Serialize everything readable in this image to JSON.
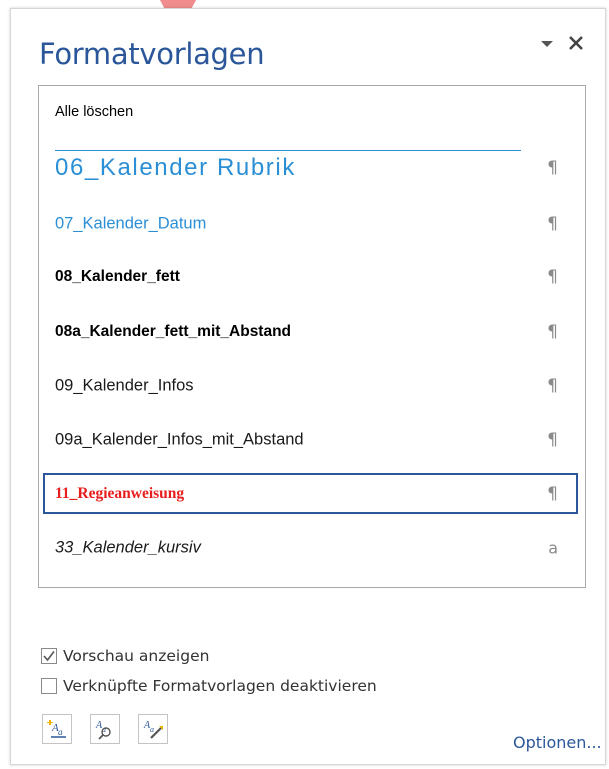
{
  "pane": {
    "title": "Formatvorlagen",
    "menu_icon": "dropdown-triangle-icon",
    "close_icon": "close-icon"
  },
  "styles": {
    "clear_all": "Alle löschen",
    "items": [
      {
        "label": "06_Kalender Rubrik",
        "mark": "¶"
      },
      {
        "label": "07_Kalender_Datum",
        "mark": "¶"
      },
      {
        "label": "08_Kalender_fett",
        "mark": "¶"
      },
      {
        "label": "08a_Kalender_fett_mit_Abstand",
        "mark": "¶"
      },
      {
        "label": "09_Kalender_Infos",
        "mark": "¶"
      },
      {
        "label": "09a_Kalender_Infos_mit_Abstand",
        "mark": "¶"
      },
      {
        "label": "11_Regieanweisung",
        "mark": "¶"
      },
      {
        "label": "33_Kalender_kursiv",
        "mark": "a"
      }
    ],
    "selected_index": 6
  },
  "options": {
    "preview": {
      "label": "Vorschau anzeigen",
      "checked": true
    },
    "disable_linked": {
      "label": "Verknüpfte Formatvorlagen deaktivieren",
      "checked": false
    }
  },
  "toolbar": {
    "buttons": [
      "new-style-icon",
      "style-inspector-icon",
      "manage-styles-icon"
    ],
    "options_link": "Optionen..."
  },
  "colors": {
    "accent": "#2b579a",
    "heading_blue": "#2b8fd6",
    "regie_red": "#e81e1e",
    "pointer_arrow": "#f08c8c"
  }
}
